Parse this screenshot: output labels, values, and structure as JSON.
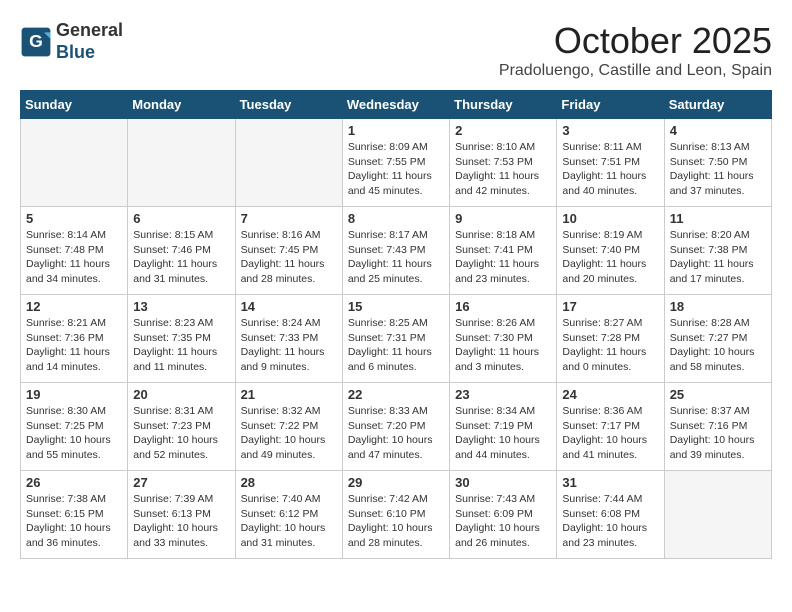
{
  "header": {
    "logo_line1": "General",
    "logo_line2": "Blue",
    "month": "October 2025",
    "location": "Pradoluengo, Castille and Leon, Spain"
  },
  "weekdays": [
    "Sunday",
    "Monday",
    "Tuesday",
    "Wednesday",
    "Thursday",
    "Friday",
    "Saturday"
  ],
  "weeks": [
    [
      {
        "day": "",
        "empty": true
      },
      {
        "day": "",
        "empty": true
      },
      {
        "day": "",
        "empty": true
      },
      {
        "day": "1",
        "sunrise": "8:09 AM",
        "sunset": "7:55 PM",
        "daylight": "11 hours and 45 minutes."
      },
      {
        "day": "2",
        "sunrise": "8:10 AM",
        "sunset": "7:53 PM",
        "daylight": "11 hours and 42 minutes."
      },
      {
        "day": "3",
        "sunrise": "8:11 AM",
        "sunset": "7:51 PM",
        "daylight": "11 hours and 40 minutes."
      },
      {
        "day": "4",
        "sunrise": "8:13 AM",
        "sunset": "7:50 PM",
        "daylight": "11 hours and 37 minutes."
      }
    ],
    [
      {
        "day": "5",
        "sunrise": "8:14 AM",
        "sunset": "7:48 PM",
        "daylight": "11 hours and 34 minutes."
      },
      {
        "day": "6",
        "sunrise": "8:15 AM",
        "sunset": "7:46 PM",
        "daylight": "11 hours and 31 minutes."
      },
      {
        "day": "7",
        "sunrise": "8:16 AM",
        "sunset": "7:45 PM",
        "daylight": "11 hours and 28 minutes."
      },
      {
        "day": "8",
        "sunrise": "8:17 AM",
        "sunset": "7:43 PM",
        "daylight": "11 hours and 25 minutes."
      },
      {
        "day": "9",
        "sunrise": "8:18 AM",
        "sunset": "7:41 PM",
        "daylight": "11 hours and 23 minutes."
      },
      {
        "day": "10",
        "sunrise": "8:19 AM",
        "sunset": "7:40 PM",
        "daylight": "11 hours and 20 minutes."
      },
      {
        "day": "11",
        "sunrise": "8:20 AM",
        "sunset": "7:38 PM",
        "daylight": "11 hours and 17 minutes."
      }
    ],
    [
      {
        "day": "12",
        "sunrise": "8:21 AM",
        "sunset": "7:36 PM",
        "daylight": "11 hours and 14 minutes."
      },
      {
        "day": "13",
        "sunrise": "8:23 AM",
        "sunset": "7:35 PM",
        "daylight": "11 hours and 11 minutes."
      },
      {
        "day": "14",
        "sunrise": "8:24 AM",
        "sunset": "7:33 PM",
        "daylight": "11 hours and 9 minutes."
      },
      {
        "day": "15",
        "sunrise": "8:25 AM",
        "sunset": "7:31 PM",
        "daylight": "11 hours and 6 minutes."
      },
      {
        "day": "16",
        "sunrise": "8:26 AM",
        "sunset": "7:30 PM",
        "daylight": "11 hours and 3 minutes."
      },
      {
        "day": "17",
        "sunrise": "8:27 AM",
        "sunset": "7:28 PM",
        "daylight": "11 hours and 0 minutes."
      },
      {
        "day": "18",
        "sunrise": "8:28 AM",
        "sunset": "7:27 PM",
        "daylight": "10 hours and 58 minutes."
      }
    ],
    [
      {
        "day": "19",
        "sunrise": "8:30 AM",
        "sunset": "7:25 PM",
        "daylight": "10 hours and 55 minutes."
      },
      {
        "day": "20",
        "sunrise": "8:31 AM",
        "sunset": "7:23 PM",
        "daylight": "10 hours and 52 minutes."
      },
      {
        "day": "21",
        "sunrise": "8:32 AM",
        "sunset": "7:22 PM",
        "daylight": "10 hours and 49 minutes."
      },
      {
        "day": "22",
        "sunrise": "8:33 AM",
        "sunset": "7:20 PM",
        "daylight": "10 hours and 47 minutes."
      },
      {
        "day": "23",
        "sunrise": "8:34 AM",
        "sunset": "7:19 PM",
        "daylight": "10 hours and 44 minutes."
      },
      {
        "day": "24",
        "sunrise": "8:36 AM",
        "sunset": "7:17 PM",
        "daylight": "10 hours and 41 minutes."
      },
      {
        "day": "25",
        "sunrise": "8:37 AM",
        "sunset": "7:16 PM",
        "daylight": "10 hours and 39 minutes."
      }
    ],
    [
      {
        "day": "26",
        "sunrise": "7:38 AM",
        "sunset": "6:15 PM",
        "daylight": "10 hours and 36 minutes."
      },
      {
        "day": "27",
        "sunrise": "7:39 AM",
        "sunset": "6:13 PM",
        "daylight": "10 hours and 33 minutes."
      },
      {
        "day": "28",
        "sunrise": "7:40 AM",
        "sunset": "6:12 PM",
        "daylight": "10 hours and 31 minutes."
      },
      {
        "day": "29",
        "sunrise": "7:42 AM",
        "sunset": "6:10 PM",
        "daylight": "10 hours and 28 minutes."
      },
      {
        "day": "30",
        "sunrise": "7:43 AM",
        "sunset": "6:09 PM",
        "daylight": "10 hours and 26 minutes."
      },
      {
        "day": "31",
        "sunrise": "7:44 AM",
        "sunset": "6:08 PM",
        "daylight": "10 hours and 23 minutes."
      },
      {
        "day": "",
        "empty": true
      }
    ]
  ]
}
